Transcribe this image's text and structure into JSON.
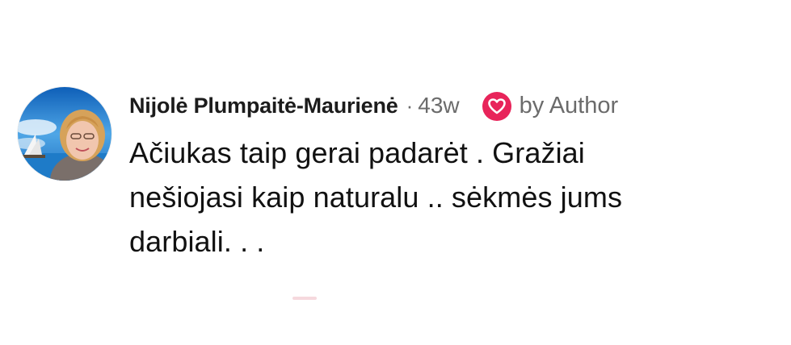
{
  "comment": {
    "author": "Nijolė Plumpaitė-Maurienė",
    "separator": "·",
    "timestamp": "43w",
    "reaction_icon": "heart-icon",
    "reaction_color": "#e8245a",
    "reaction_label": "by Author",
    "text": "Ačiukas taip gerai padarėt .  Gražiai\nnešiojasi kaip naturalu .. sėkmės jums\ndarbiali. . ."
  }
}
